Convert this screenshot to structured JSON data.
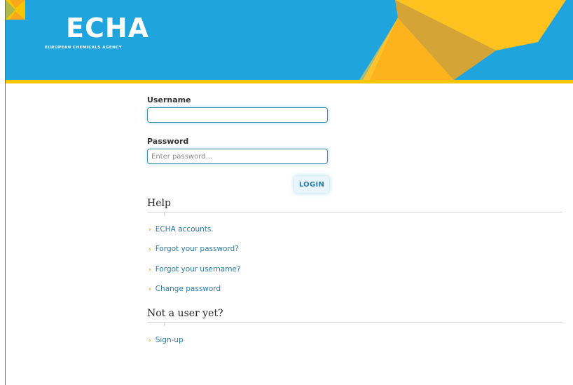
{
  "header": {
    "logo_text": "ECHA",
    "logo_subtitle": "EUROPEAN CHEMICALS AGENCY",
    "colors": {
      "background": "#1fa4dd",
      "accent": "#f7c600"
    }
  },
  "form": {
    "username_label": "Username",
    "username_value": "",
    "password_label": "Password",
    "password_placeholder": "Enter password...",
    "login_label": "LOGIN"
  },
  "help": {
    "title": "Help",
    "links": [
      {
        "label": "ECHA accounts.",
        "icon": "chevron-right-icon"
      },
      {
        "label": "Forgot your password?",
        "icon": "chevron-right-icon"
      },
      {
        "label": "Forgot your username?",
        "icon": "chevron-right-icon"
      },
      {
        "label": "Change password",
        "icon": "chevron-right-icon"
      }
    ]
  },
  "signup": {
    "title": "Not a user yet?",
    "links": [
      {
        "label": "Sign-up",
        "icon": "chevron-right-icon"
      }
    ]
  },
  "icons": {
    "chevron": "›"
  }
}
